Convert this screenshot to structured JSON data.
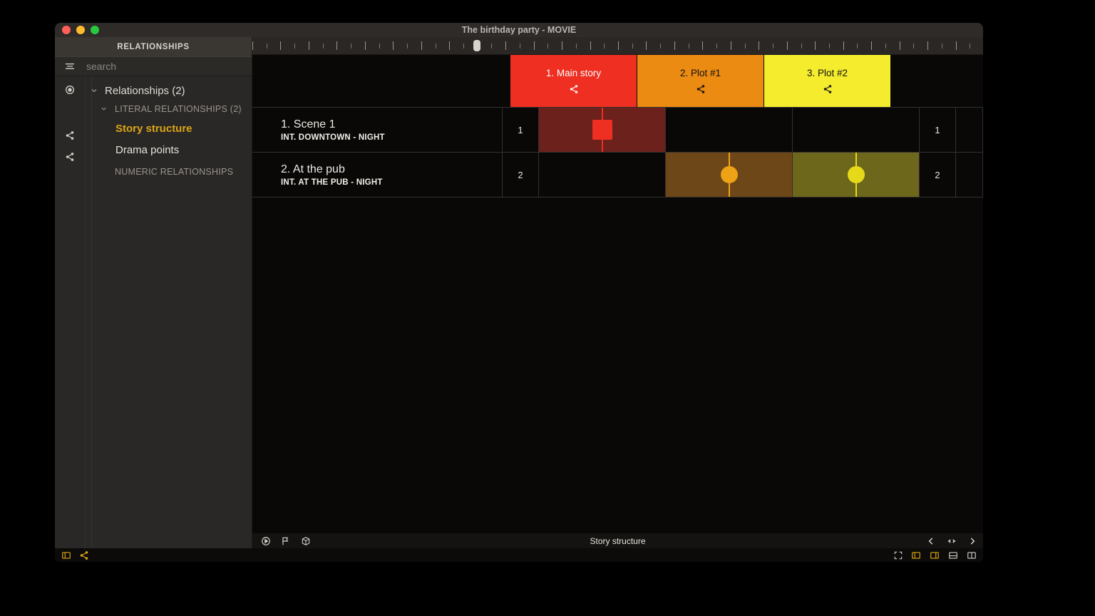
{
  "title": "The birthday party - MOVIE",
  "sidebar": {
    "head_label": "RELATIONSHIPS",
    "search_placeholder": "search",
    "root_label": "Relationships (2)",
    "group_literal": "LITERAL RELATIONSHIPS (2)",
    "group_numeric": "NUMERIC RELATIONSHIPS",
    "leaves": [
      "Story structure",
      "Drama points"
    ]
  },
  "plots": [
    {
      "label": "1. Main story",
      "color": "#ee2f22"
    },
    {
      "label": "2. Plot #1",
      "color": "#eb8b12"
    },
    {
      "label": "3. Plot #2",
      "color": "#f5ec2e"
    }
  ],
  "rows": [
    {
      "n": "1",
      "title": "1. Scene 1",
      "sub": "INT.  DOWNTOWN - NIGHT",
      "marks": [
        {
          "plot": 0,
          "shape": "square"
        }
      ]
    },
    {
      "n": "2",
      "title": "2. At the pub",
      "sub": "INT.  AT THE PUB - NIGHT",
      "marks": [
        {
          "plot": 1,
          "shape": "circle"
        },
        {
          "plot": 2,
          "shape": "circle"
        }
      ]
    }
  ],
  "footer_center": "Story structure"
}
